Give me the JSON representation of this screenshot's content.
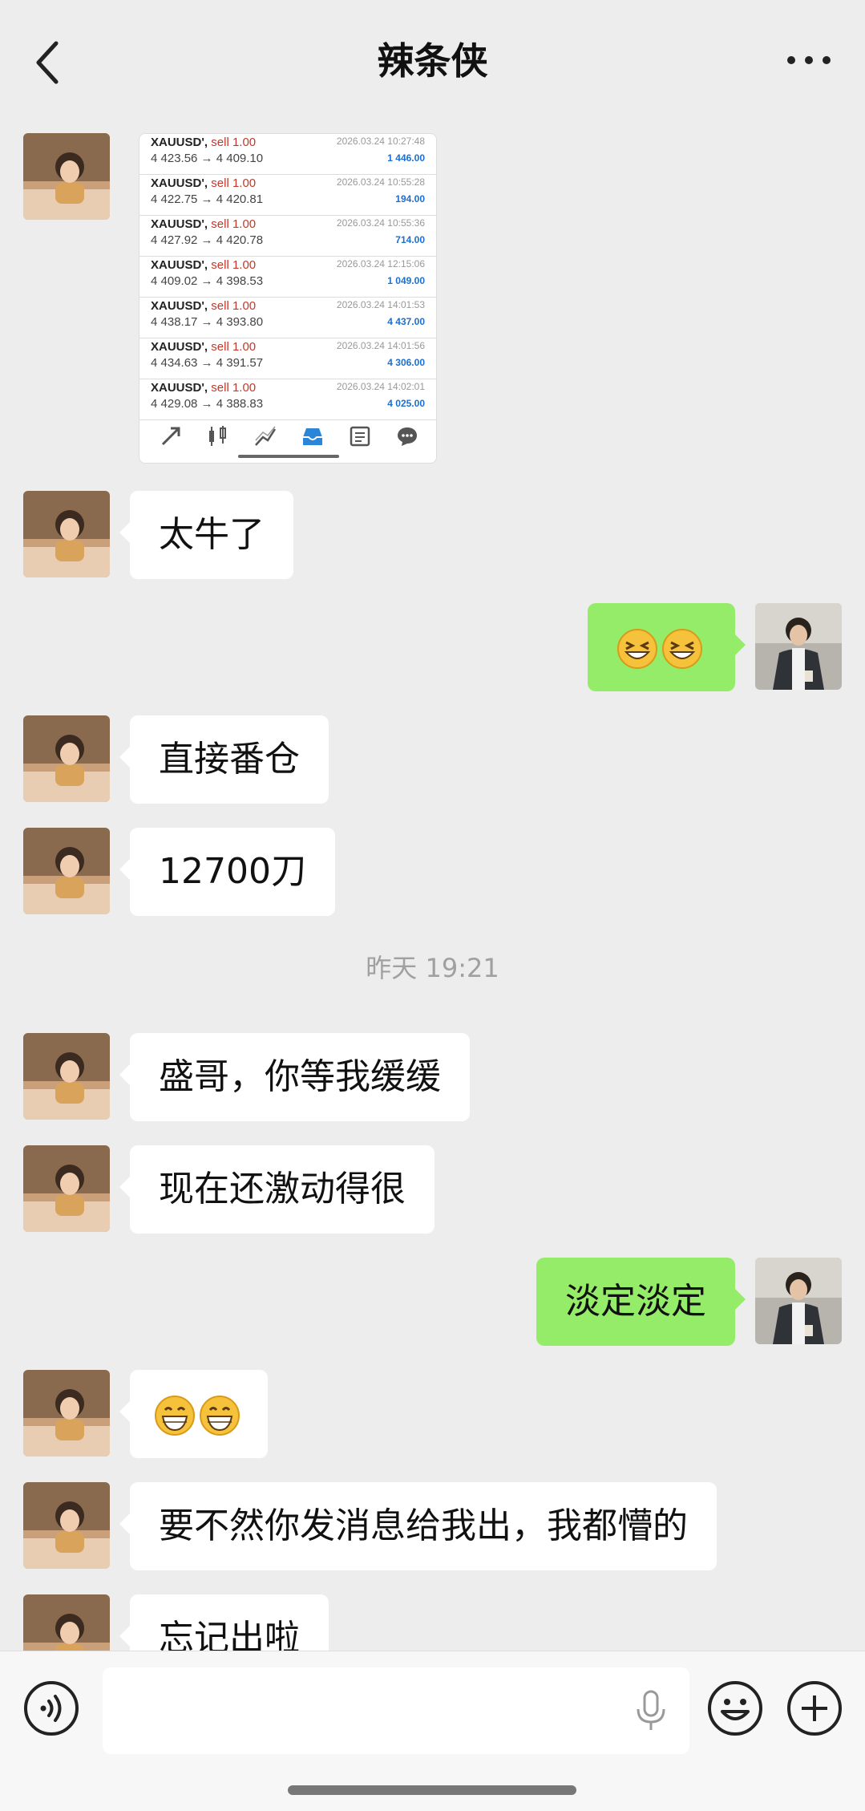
{
  "header": {
    "title": "辣条侠"
  },
  "trades": [
    {
      "symbol": "XAUUSD'",
      "action": "sell 1.00",
      "prices": "4 423.56 → 4 409.10",
      "time": "2026.03.24 10:27:48",
      "profit": "1 446.00"
    },
    {
      "symbol": "XAUUSD'",
      "action": "sell 1.00",
      "prices": "4 422.75 → 4 420.81",
      "time": "2026.03.24 10:55:28",
      "profit": "194.00"
    },
    {
      "symbol": "XAUUSD'",
      "action": "sell 1.00",
      "prices": "4 427.92 → 4 420.78",
      "time": "2026.03.24 10:55:36",
      "profit": "714.00"
    },
    {
      "symbol": "XAUUSD'",
      "action": "sell 1.00",
      "prices": "4 409.02 → 4 398.53",
      "time": "2026.03.24 12:15:06",
      "profit": "1 049.00"
    },
    {
      "symbol": "XAUUSD'",
      "action": "sell 1.00",
      "prices": "4 438.17 → 4 393.80",
      "time": "2026.03.24 14:01:53",
      "profit": "4 437.00"
    },
    {
      "symbol": "XAUUSD'",
      "action": "sell 1.00",
      "prices": "4 434.63 → 4 391.57",
      "time": "2026.03.24 14:01:56",
      "profit": "4 306.00"
    },
    {
      "symbol": "XAUUSD'",
      "action": "sell 1.00",
      "prices": "4 429.08 → 4 388.83",
      "time": "2026.03.24 14:02:01",
      "profit": "4 025.00"
    }
  ],
  "messages": {
    "m1": "太牛了",
    "m2_emoji": "grinning-squinting-emoji",
    "m3": "直接番仓",
    "m4": "12700刀",
    "timestamp": "昨天 19:21",
    "m5": "盛哥，你等我缓缓",
    "m6": "现在还激动得很",
    "m7": "淡定淡定",
    "m8_emoji": "grinning-emoji",
    "m9": "要不然你发消息给我出，我都懵的",
    "m10": "忘记出啦"
  },
  "colors": {
    "background": "#ededed",
    "self_bubble": "#95ec69",
    "other_bubble": "#ffffff",
    "profit": "#1c6fd0",
    "sell": "#c0392b"
  }
}
